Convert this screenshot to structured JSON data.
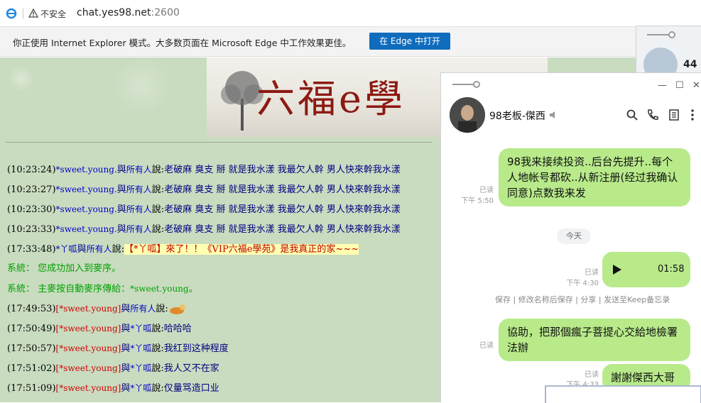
{
  "browser": {
    "insecure_label": "不安全",
    "url_host": "chat.yes98.net",
    "url_port": ":2600"
  },
  "ie_banner": {
    "message": "你正使用 Internet Explorer 模式。大多数页面在 Microsoft Edge 中工作效果更佳。",
    "button": "在 Edge 中打开"
  },
  "chat_site": {
    "banner_title": "六福e學",
    "log": [
      {
        "time": "(10:23:24)",
        "from": "*sweet.young.",
        "mid": "與",
        "to": "所有人",
        "say": "說:",
        "msg": "老破麻 臭支 掰 就是我水漾 我最欠人幹 男人快來幹我水漾"
      },
      {
        "time": "(10:23:27)",
        "from": "*sweet.young.",
        "mid": "與",
        "to": "所有人",
        "say": "說:",
        "msg": "老破麻 臭支 掰 就是我水漾 我最欠人幹 男人快來幹我水漾"
      },
      {
        "time": "(10:23:30)",
        "from": "*sweet.young.",
        "mid": "與",
        "to": "所有人",
        "say": "說:",
        "msg": "老破麻 臭支 掰 就是我水漾 我最欠人幹 男人快來幹我水漾"
      },
      {
        "time": "(10:23:33)",
        "from": "*sweet.young.",
        "mid": "與",
        "to": "所有人",
        "say": "說:",
        "msg": "老破麻 臭支 掰 就是我水漾 我最欠人幹 男人快來幹我水漾"
      },
      {
        "time": "(17:33:48)",
        "from": "*丫呱",
        "mid": "與",
        "to": "所有人",
        "say": "說:",
        "msg": "【*丫呱】來了！！《VIP六福e學苑》是我真正的家~~~"
      }
    ],
    "system_lines": [
      {
        "prefix": "系統：",
        "msg": "您成功加入到麥序。"
      },
      {
        "prefix": "系統：",
        "msg": "主麥按自動麥序傳給：",
        "user": "*sweet.young",
        "end": "。"
      }
    ],
    "log2": [
      {
        "time": "(17:49:53)",
        "from": "[*sweet.young]",
        "mid": "與",
        "to": "所有人",
        "say": "說:",
        "msg": ""
      },
      {
        "time": "(17:50:49)",
        "from": "[*sweet.young]",
        "mid": "與",
        "to": "*丫呱",
        "say": "說:",
        "msg": "哈哈哈"
      },
      {
        "time": "(17:50:57)",
        "from": "[*sweet.young]",
        "mid": "與",
        "to": "*丫呱",
        "say": "說:",
        "msg": "我红到这种程度"
      },
      {
        "time": "(17:51:02)",
        "from": "[*sweet.young]",
        "mid": "與",
        "to": "*丫呱",
        "say": "說:",
        "msg": "我人又不在家"
      },
      {
        "time": "(17:51:09)",
        "from": "[*sweet.young]",
        "mid": "與",
        "to": "*丫呱",
        "say": "說:",
        "msg": "仅量骂造口业"
      }
    ]
  },
  "messenger": {
    "back_count": "44",
    "contact_name": "98老板-傑西",
    "msg1": {
      "text": "98我来接续投资..后台先提升..每个人地帐号都砍..从新注册(经过我确认同意)点数我来发",
      "read": "已读",
      "time": "下午 5:50"
    },
    "day_chip": "今天",
    "voice": {
      "duration": "01:58",
      "read": "已读",
      "time": "下午 4:30"
    },
    "voice_actions": "保存 | 修改名称后保存 | 分享 | 发送至Keep备忘录",
    "msg2": {
      "text": "協助，把那個瘋子菩提心交給地檢署法辦",
      "read": "已读"
    },
    "msg3": {
      "text": "謝謝傑西大哥",
      "read": "已读",
      "time": "下午 4:33"
    }
  }
}
